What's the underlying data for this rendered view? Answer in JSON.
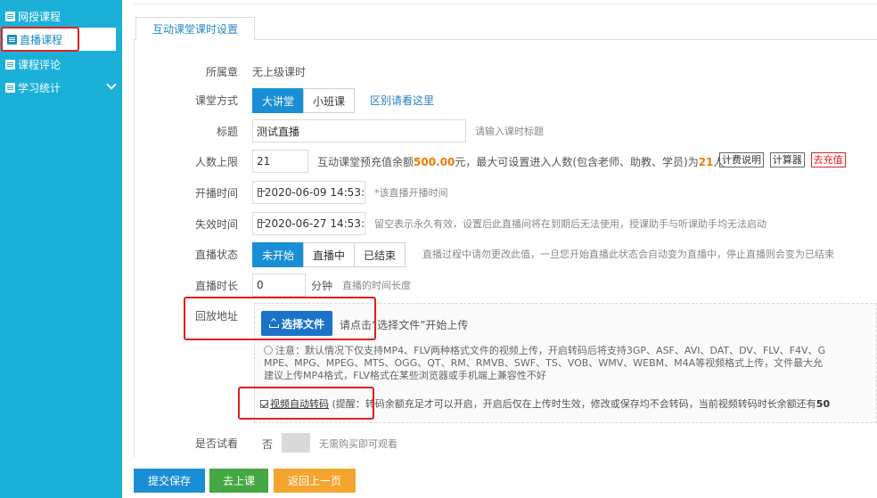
{
  "sidebar": {
    "items": [
      {
        "label": "网授课程"
      },
      {
        "label": "直播课程"
      },
      {
        "label": "课程评论"
      },
      {
        "label": "学习统计"
      }
    ]
  },
  "tab": {
    "label": "互动课堂课时设置"
  },
  "form": {
    "chapter": {
      "label": "所属章",
      "value": "无上级课时"
    },
    "mode": {
      "label": "课堂方式",
      "options": [
        "大讲堂",
        "小班课"
      ],
      "selected": "大讲堂",
      "link": "区别请看这里"
    },
    "title": {
      "label": "标题",
      "value": "测试直播",
      "hint": "请输入课时标题"
    },
    "capacity": {
      "label": "人数上限",
      "value": "21",
      "text_prefix": "互动课堂预充值余额",
      "balance": "500.00",
      "text_mid": "元，最大可设置进入人数(包含老师、助教、学员)为",
      "max": "21",
      "text_suffix": "人",
      "btn_fee": "计费说明",
      "btn_calc": "计算器",
      "btn_recharge": "去充值"
    },
    "start_time": {
      "label": "开播时间",
      "value": "2020-06-09 14:53:",
      "hint": "*该直播开播时间"
    },
    "expire_time": {
      "label": "失效时间",
      "value": "2020-06-27 14:53:",
      "hint": "留空表示永久有效，设置后此直播间将在到期后无法使用，授课助手与听课助手均无法启动"
    },
    "status": {
      "label": "直播状态",
      "options": [
        "未开始",
        "直播中",
        "已结束"
      ],
      "selected": "未开始",
      "hint": "直播过程中请勿更改此值，一旦您开始直播此状态会自动变为直播中，停止直播则会变为已结束"
    },
    "duration": {
      "label": "直播时长",
      "value": "0",
      "unit": "分钟",
      "hint": "直播的时间长度"
    },
    "replay": {
      "label": "回放地址",
      "upload_label": "选择文件",
      "upload_hint": "请点击“选择文件”开始上传",
      "note_line1": "注意：默认情况下仅支持MP4、FLV两种格式文件的视频上传，开启转码后将支持3GP、ASF、AVI、DAT、DV、FLV、F4V、G",
      "note_line2": "MPE、MPG、MPEG、MTS、OGG、QT、RM、RMVB、SWF、TS、VOB、WMV、WEBM、M4A等视频格式上传，文件最大允",
      "note_line3": "建议上传MP4格式，FLV格式在某些浏览器或手机端上兼容性不好",
      "auto_transcode": "视频自动转码",
      "remind_prefix": "(提醒：",
      "remind_text": "转码余额充足才可以开启，开启后仅在上传时生效，修改或保存均不会转码，当前视频转码时长余额还有",
      "remind_value": "50"
    },
    "trial": {
      "label": "是否试看",
      "value": "否",
      "hint": "无需购买即可观看"
    }
  },
  "footer": {
    "submit": "提交保存",
    "go_class": "去上课",
    "back": "返回上一页"
  },
  "colors": {
    "sidebar_bg": "#1bb0d8",
    "primary": "#1a8ed5",
    "submit": "#1a8ed5",
    "go_class": "#45a842",
    "back": "#f3a52f",
    "highlight": "#e0201f"
  }
}
